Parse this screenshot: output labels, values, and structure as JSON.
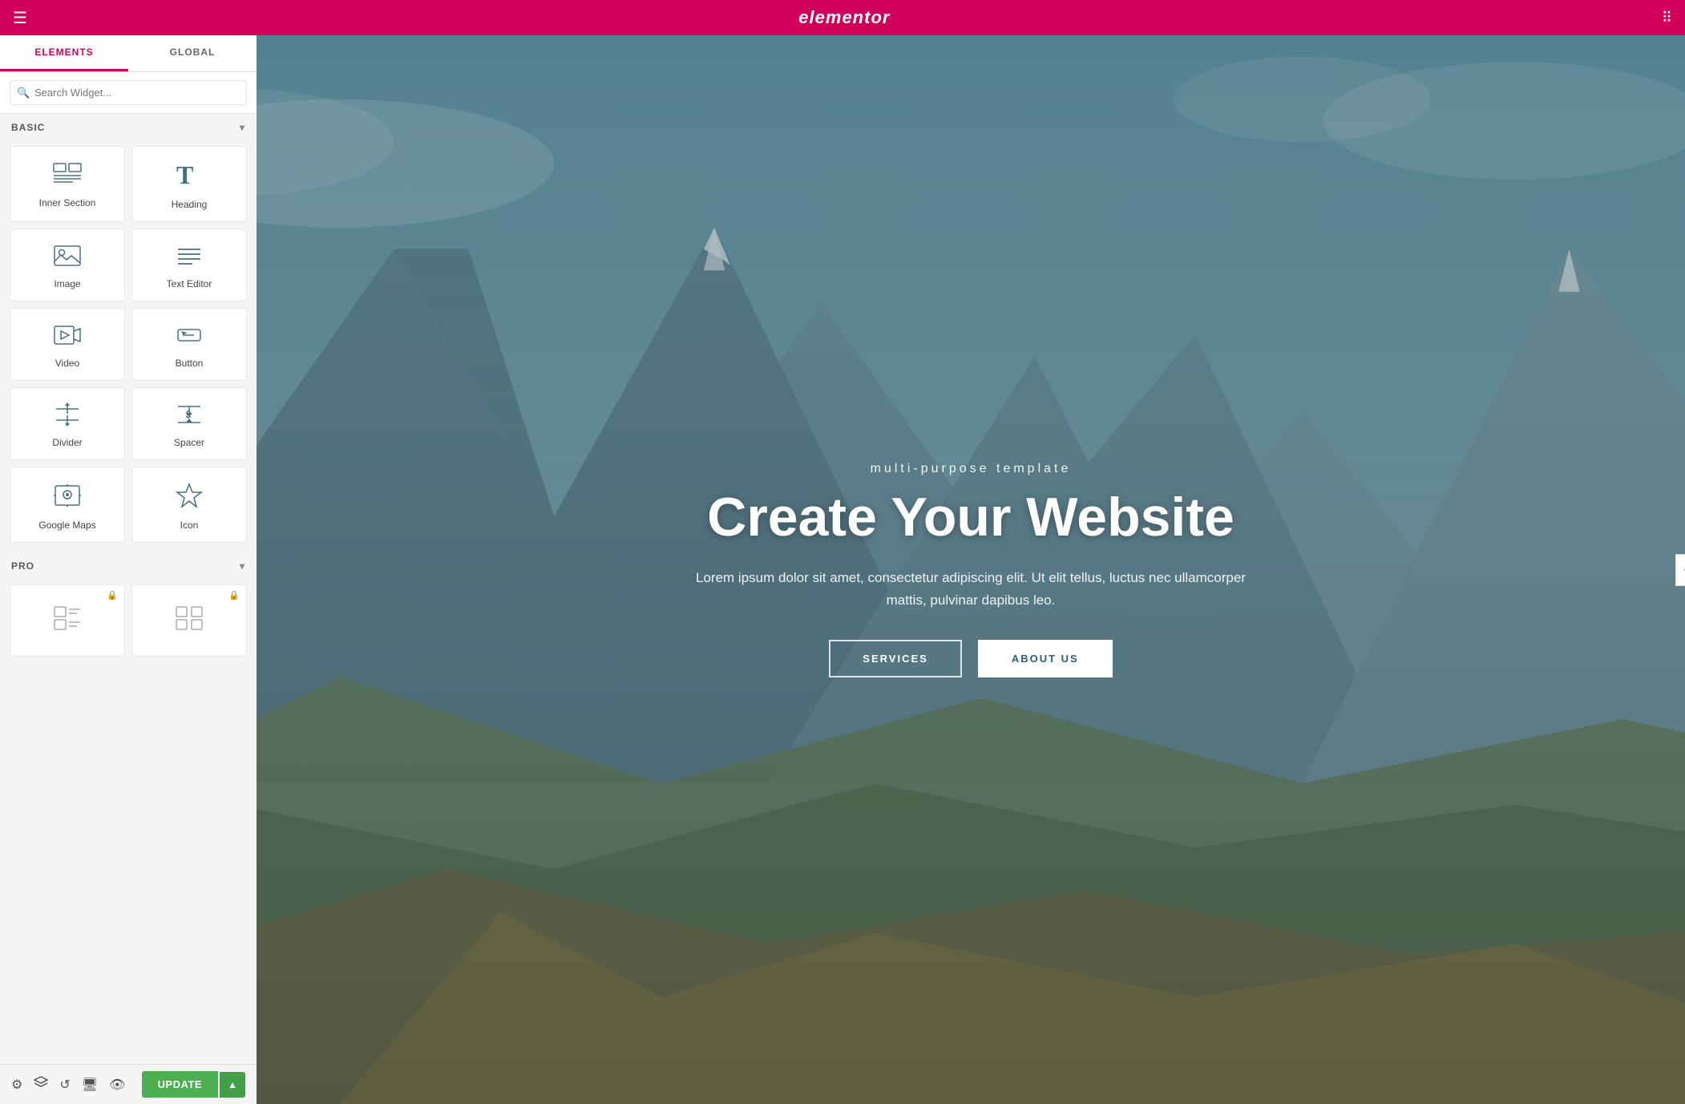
{
  "topbar": {
    "logo": "elementor",
    "hamburger_icon": "☰",
    "grid_icon": "⠿"
  },
  "sidebar": {
    "tabs": [
      {
        "id": "elements",
        "label": "ELEMENTS",
        "active": true
      },
      {
        "id": "global",
        "label": "GLOBAL",
        "active": false
      }
    ],
    "search_placeholder": "Search Widget...",
    "sections": [
      {
        "id": "basic",
        "label": "BASIC",
        "expanded": true,
        "widgets": [
          {
            "id": "inner-section",
            "label": "Inner Section",
            "icon": "inner-section-icon",
            "locked": false
          },
          {
            "id": "heading",
            "label": "Heading",
            "icon": "heading-icon",
            "locked": false
          },
          {
            "id": "image",
            "label": "Image",
            "icon": "image-icon",
            "locked": false
          },
          {
            "id": "text-editor",
            "label": "Text Editor",
            "icon": "text-editor-icon",
            "locked": false
          },
          {
            "id": "video",
            "label": "Video",
            "icon": "video-icon",
            "locked": false
          },
          {
            "id": "button",
            "label": "Button",
            "icon": "button-icon",
            "locked": false
          },
          {
            "id": "divider",
            "label": "Divider",
            "icon": "divider-icon",
            "locked": false
          },
          {
            "id": "spacer",
            "label": "Spacer",
            "icon": "spacer-icon",
            "locked": false
          },
          {
            "id": "google-maps",
            "label": "Google Maps",
            "icon": "maps-icon",
            "locked": false
          },
          {
            "id": "icon",
            "label": "Icon",
            "icon": "icon-widget-icon",
            "locked": false
          }
        ]
      },
      {
        "id": "pro",
        "label": "PRO",
        "expanded": true,
        "widgets": [
          {
            "id": "pro-widget-1",
            "label": "",
            "icon": "pro-list-icon",
            "locked": true
          },
          {
            "id": "pro-widget-2",
            "label": "",
            "icon": "pro-grid-icon",
            "locked": true
          }
        ]
      }
    ]
  },
  "bottom_bar": {
    "icons": [
      "gear-icon",
      "layers-icon",
      "history-icon",
      "desktop-icon",
      "eye-icon"
    ],
    "update_label": "UPDATE",
    "dropdown_arrow": "▲"
  },
  "canvas": {
    "hero_subtitle": "multi-purpose template",
    "hero_title": "Create Your Website",
    "hero_desc": "Lorem ipsum dolor sit amet, consectetur adipiscing elit. Ut elit tellus, luctus nec ullamcorper mattis, pulvinar dapibus leo.",
    "btn1_label": "SERVICES",
    "btn2_label": "ABOUT US"
  }
}
